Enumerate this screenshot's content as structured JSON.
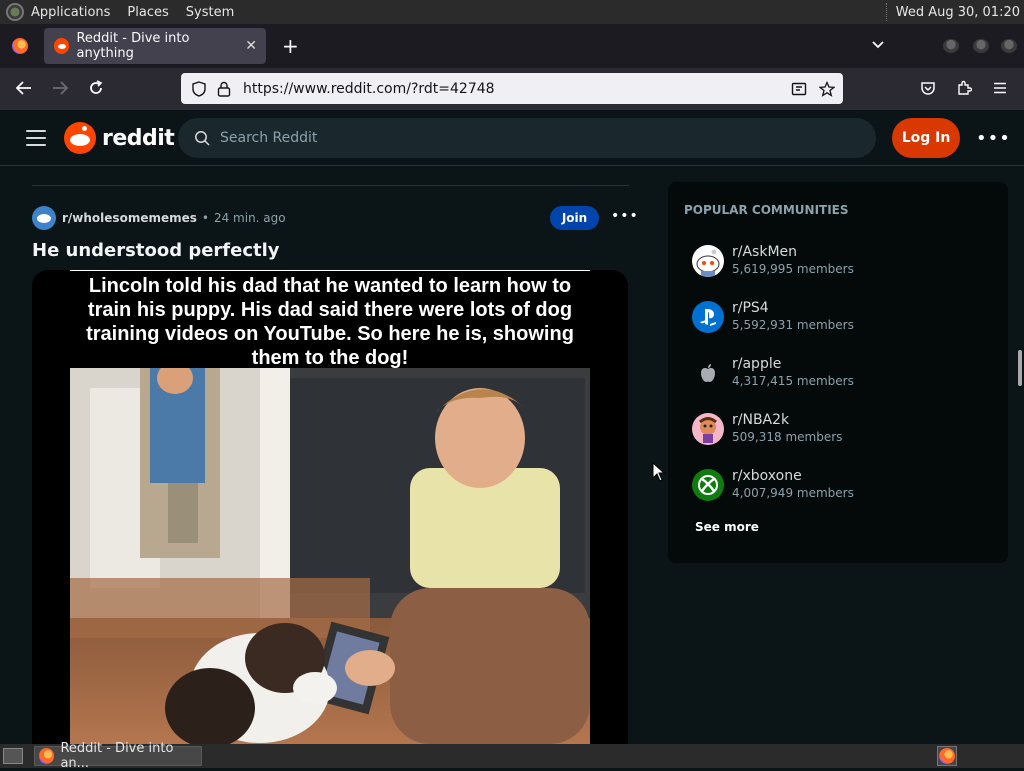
{
  "top_panel": {
    "menus": [
      "Applications",
      "Places",
      "System"
    ],
    "clock": "Wed Aug 30, 01:20"
  },
  "browser": {
    "tab_title": "Reddit - Dive into anything",
    "tab_close": "✕",
    "new_tab": "+",
    "url": "https://www.reddit.com/?rdt=42748"
  },
  "reddit_header": {
    "logo_text": "reddit",
    "search_placeholder": "Search Reddit",
    "login_label": "Log In",
    "more": "•••"
  },
  "post": {
    "subreddit": "r/wholesomememes",
    "separator": "•",
    "time_ago": "24 min. ago",
    "join_label": "Join",
    "more": "•••",
    "title": "He understood perfectly",
    "image_caption": "Lincoln told his dad that he wanted to learn how to train his puppy. His dad said there were lots of dog training videos on YouTube. So here he is, showing them to the dog!"
  },
  "sidebar": {
    "heading": "POPULAR COMMUNITIES",
    "communities": [
      {
        "name": "r/AskMen",
        "members": "5,619,995 members",
        "icon": "askmen-icon"
      },
      {
        "name": "r/PS4",
        "members": "5,592,931 members",
        "icon": "playstation-icon"
      },
      {
        "name": "r/apple",
        "members": "4,317,415 members",
        "icon": "apple-icon"
      },
      {
        "name": "r/NBA2k",
        "members": "509,318 members",
        "icon": "nba2k-icon"
      },
      {
        "name": "r/xboxone",
        "members": "4,007,949 members",
        "icon": "xbox-icon"
      }
    ],
    "see_more": "See more"
  },
  "taskbar": {
    "task_label": "Reddit - Dive into an..."
  },
  "colors": {
    "reddit_orange": "#ff4500",
    "login_bg": "#d93900",
    "join_bg": "#0045ac",
    "page_bg": "#0b1416"
  }
}
